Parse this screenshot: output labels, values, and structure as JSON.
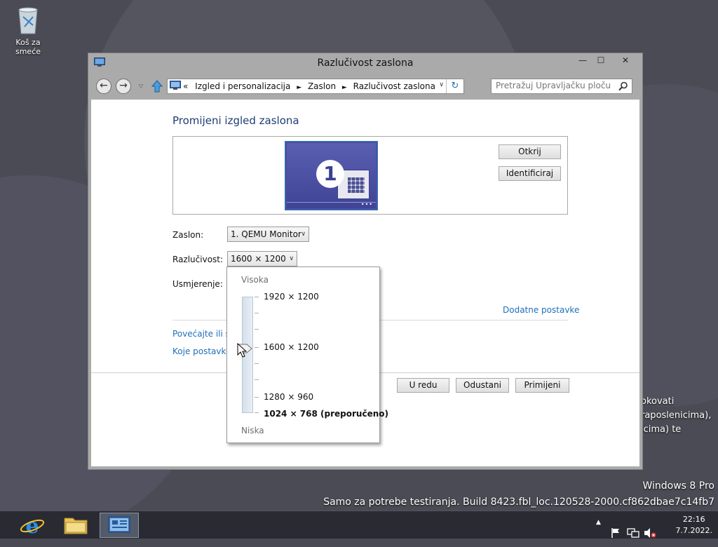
{
  "desktop": {
    "recycle_bin_label": "Koš za smeće",
    "side_text": [
      "okovati",
      "raposlenicima),",
      "icima) te"
    ],
    "watermark_edition": "Windows 8 Pro",
    "watermark_build": "Samo za potrebe testiranja. Build 8423.fbl_loc.120528-2000.cf862dbae7c14fb7"
  },
  "window": {
    "title": "Razlučivost zaslona",
    "min_symbol": "—",
    "max_symbol": "☐",
    "close_symbol": "✕",
    "nav": {
      "back_symbol": "←",
      "forward_symbol": "→",
      "recent_symbol": "▽",
      "address_prefix": "«",
      "breadcrumbs": [
        "Izgled i personalizacija",
        "Zaslon",
        "Razlučivost zaslona"
      ],
      "breadcrumb_sep": "►",
      "dropdown_symbol": "∨",
      "refresh_symbol": "↻",
      "search_placeholder": "Pretražuj Upravljačku ploču"
    },
    "content": {
      "heading": "Promijeni izgled zaslona",
      "monitor_number": "1",
      "monitor_dots": "•••",
      "detect_label": "Otkrij",
      "identify_label": "Identificiraj",
      "display_label": "Zaslon:",
      "display_value": "1. QEMU Monitor",
      "resolution_label": "Razlučivost:",
      "resolution_value": "1600 × 1200",
      "orientation_label": "Usmjerenje:",
      "advanced_link": "Dodatne postavke",
      "link1": "Povećajte ili sm",
      "link2": "Koje postavke p",
      "ok_label": "U redu",
      "cancel_label": "Odustani",
      "apply_label": "Primijeni",
      "select_arrow": "∨"
    },
    "resolution_popup": {
      "high_label": "Visoka",
      "low_label": "Niska",
      "options": [
        "1920 × 1200",
        "1600 × 1200",
        "1280 × 960",
        "1024 × 768 (preporučeno)"
      ],
      "selected_fraction": 0.4
    }
  },
  "taskbar": {
    "clock_time": "22:16",
    "clock_date": "7.7.2022.",
    "tray_arrow": "▲"
  }
}
